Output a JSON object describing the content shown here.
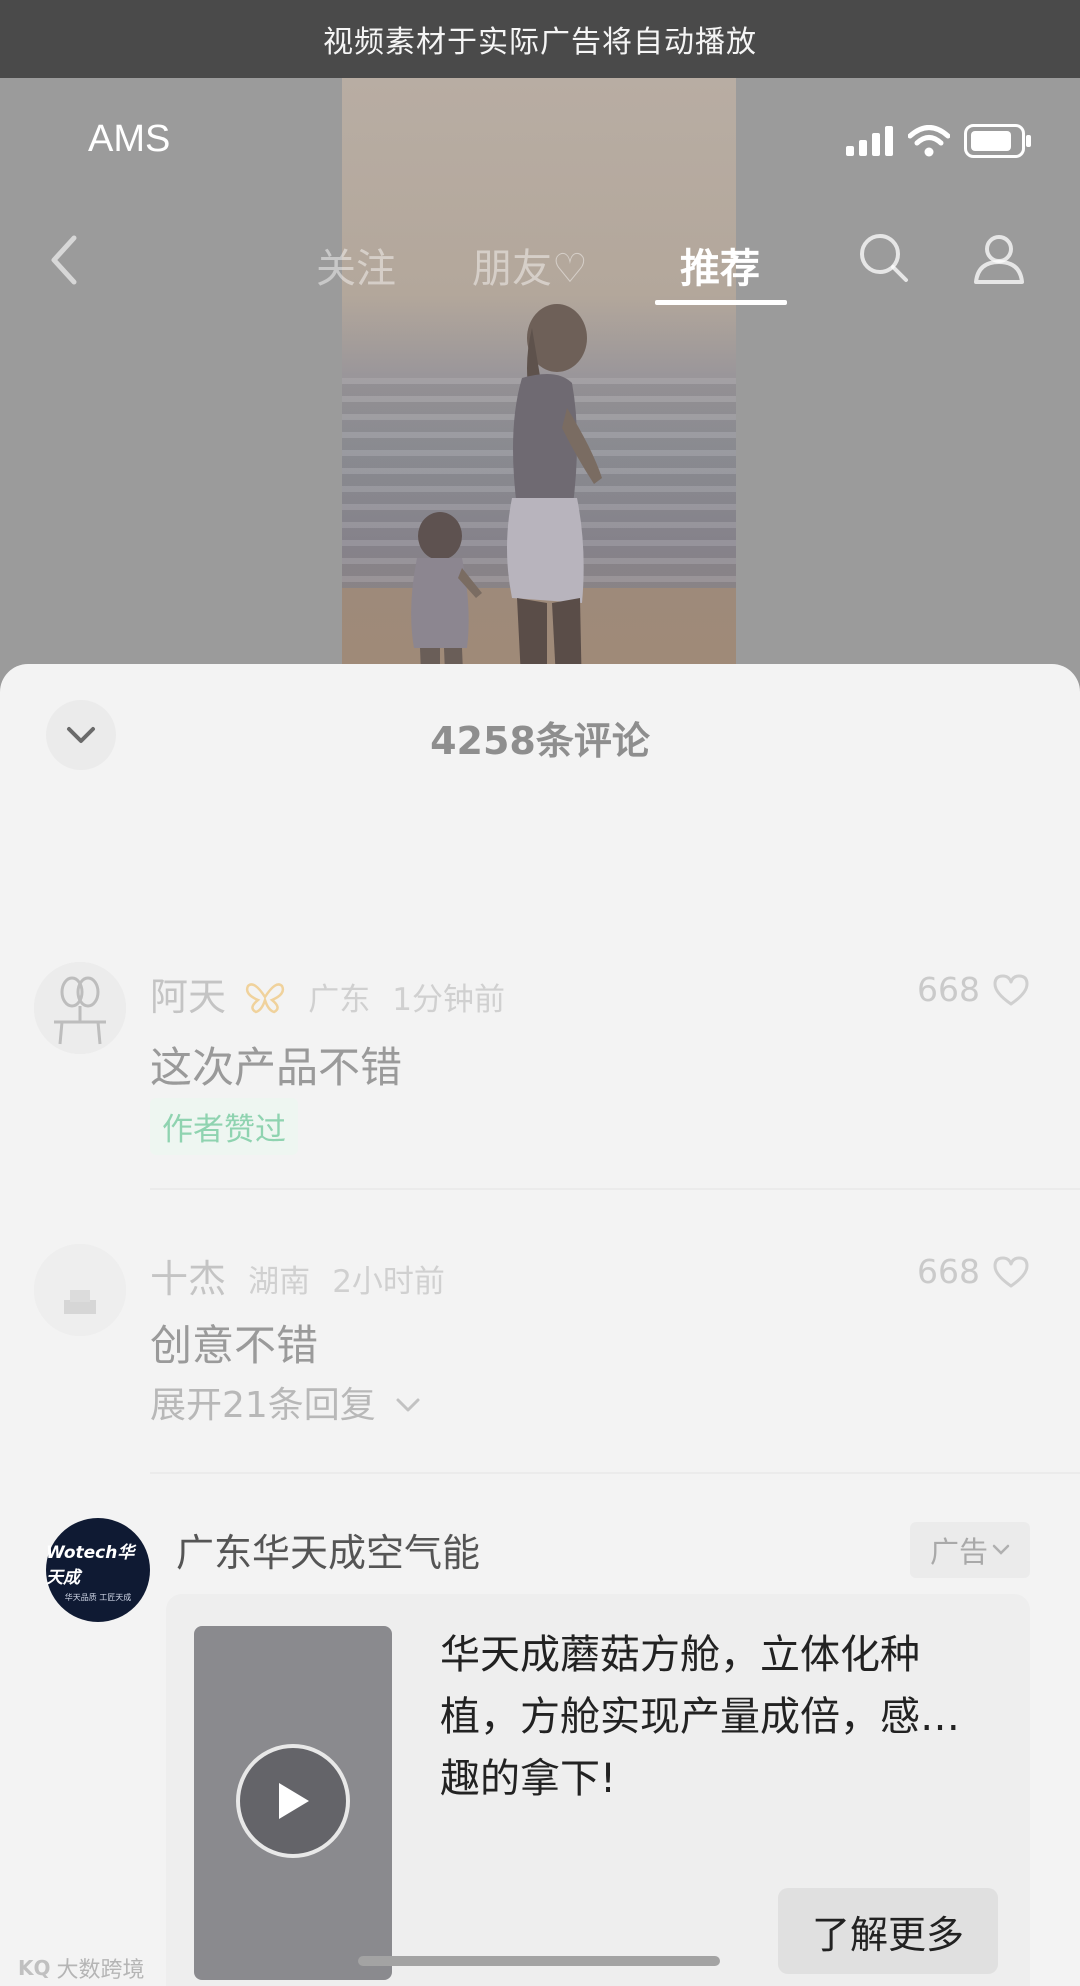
{
  "banner": {
    "text": "视频素材于实际广告将自动播放"
  },
  "status_bar": {
    "carrier": "AMS",
    "icons": [
      "signal-icon",
      "wifi-icon",
      "battery-icon"
    ]
  },
  "top_nav": {
    "tabs": [
      {
        "label": "关注",
        "active": false
      },
      {
        "label": "朋友♡",
        "active": false
      },
      {
        "label": "推荐",
        "active": true
      }
    ],
    "icons": [
      "back-icon",
      "search-icon",
      "user-icon"
    ]
  },
  "comments_sheet": {
    "title": "4258条评论",
    "comments": [
      {
        "name": "阿天",
        "location": "广东",
        "time": "1分钟前",
        "text": "这次产品不错",
        "likes": "668",
        "badge": "作者赞过"
      },
      {
        "name": "十杰",
        "location": "湖南",
        "time": "2小时前",
        "text": "创意不错",
        "likes": "668",
        "expand": "展开21条回复"
      }
    ],
    "ad": {
      "advertiser": "广东华天成空气能",
      "tag": "广告",
      "logo_text": "Wotech华天成",
      "logo_sub": "华天品质 工匠天成",
      "description_line1": "华天成蘑菇方舱，立体化种",
      "description_line2": "植，方舱实现产量成倍，感…",
      "description_line3": "趣的拿下!",
      "cta": "了解更多"
    }
  },
  "watermark": {
    "logo": "KQ",
    "text": "大数跨境"
  }
}
